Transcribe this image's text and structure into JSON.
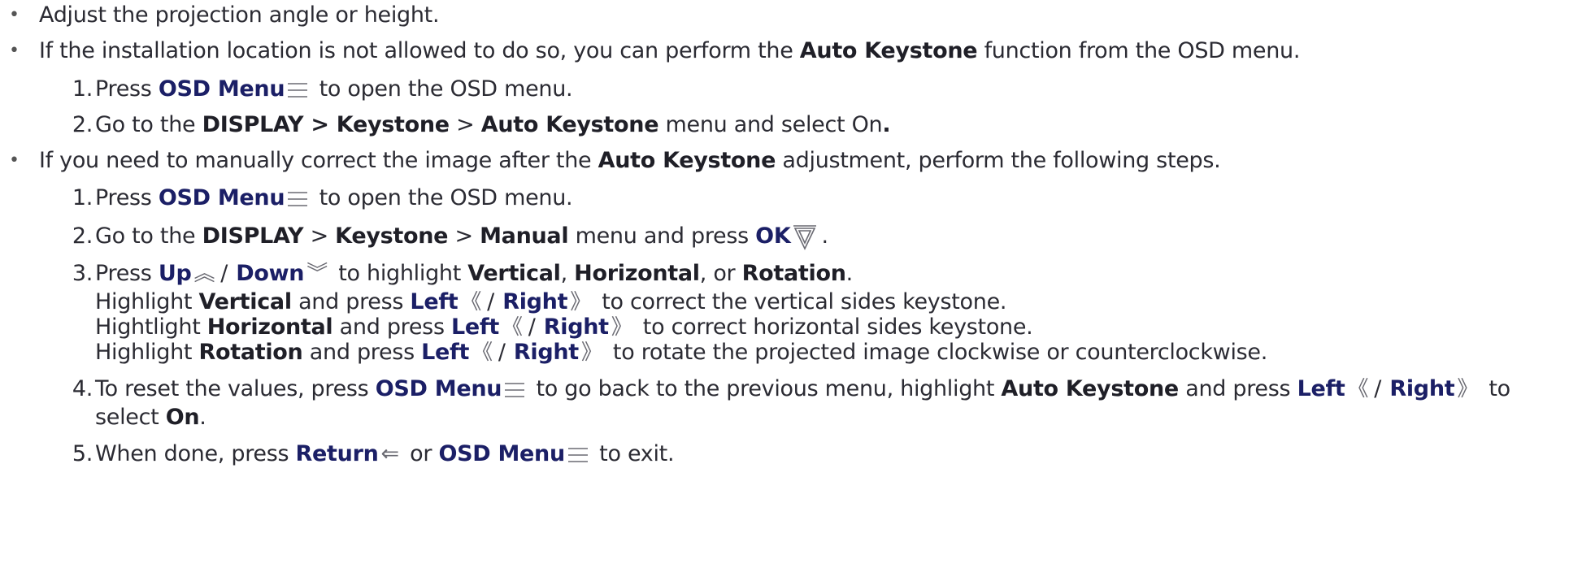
{
  "b1": "Adjust the projection angle or height.",
  "b2": {
    "t1": "If the installation location is not allowed to do so, you can perform the ",
    "k1": "Auto Keystone",
    "t2": " function from the OSD menu."
  },
  "s1": {
    "n": "1.",
    "t1": "Press ",
    "k1": "OSD Menu",
    "t2": " to open the OSD menu."
  },
  "s2": {
    "n": "2.",
    "t1": "Go to the ",
    "k1": "DISPLAY > Keystone",
    "t2": " > ",
    "k2": "Auto Keystone",
    "t3": " menu and select On",
    "t4": "."
  },
  "b3": {
    "t1": "If you need to manually correct the image after the ",
    "k1": "Auto Keystone",
    "t2": " adjustment, perform the following steps."
  },
  "m1": {
    "n": "1.",
    "t1": "Press ",
    "k1": "OSD Menu",
    "t2": " to open the OSD menu."
  },
  "m2": {
    "n": "2.",
    "t1": "Go to the ",
    "k1": "DISPLAY",
    "t2": " > ",
    "k2": "Keystone",
    "t3": " > ",
    "k3": "Manual",
    "t4": " menu and press ",
    "k4": "OK",
    "t5": "."
  },
  "m3": {
    "n": "3.",
    "t1": "Press ",
    "k1": "Up",
    "t2": " / ",
    "k2": "Down",
    "t3": " to highlight ",
    "k3": "Vertical",
    "t4": ", ",
    "k4": "Horizontal",
    "t5": ", or ",
    "k5": "Rotation",
    "t6": "."
  },
  "m3a": {
    "t1": "Highlight ",
    "k1": "Vertical",
    "t2": " and press ",
    "k2": "Left",
    "k3": "Right",
    "t3": " to correct the vertical sides keystone."
  },
  "m3b": {
    "t1": "Hightlight ",
    "k1": "Horizontal",
    "t2": " and press ",
    "k2": "Left",
    "k3": "Right",
    "t3": " to correct horizontal sides keystone."
  },
  "m3c": {
    "t1": "Highlight ",
    "k1": "Rotation",
    "t2": " and press ",
    "k2": "Left",
    "k3": "Right",
    "t3": " to rotate the projected image clockwise or counterclockwise."
  },
  "m4": {
    "n": "4.",
    "t1": "To reset the values, press ",
    "k1": "OSD Menu",
    "t2": " to go back to the previous menu, highlight ",
    "k2": "Auto Keystone",
    "t3": " and press ",
    "k3": "Left",
    "k4": "Right",
    "t4": " to"
  },
  "m4b": {
    "t1": "select ",
    "k1": "On",
    "t2": "."
  },
  "m5": {
    "n": "5.",
    "t1": "When done, press ",
    "k1": "Return",
    "t2": " or ",
    "k2": "OSD Menu",
    "t3": " to exit."
  },
  "sep_slash": "/",
  "glyphs": {
    "bullet": "•",
    "up": "︽",
    "down": "︾",
    "left": "《",
    "right": "》",
    "return": "⇐"
  },
  "icons": [
    "menu-icon",
    "ok-icon",
    "up-icon",
    "down-icon",
    "left-icon",
    "right-icon",
    "return-icon"
  ],
  "colors": {
    "text": "#2b2b33",
    "key": "#1b1f66",
    "icon": "#6a6a72"
  }
}
